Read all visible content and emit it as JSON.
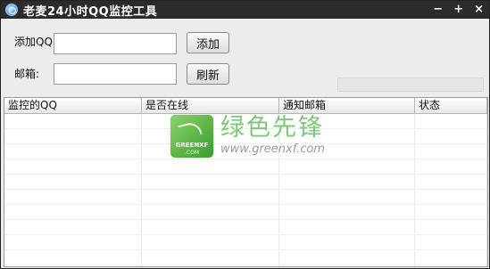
{
  "window": {
    "title": "老麦24小时QQ监控工具",
    "minimize": "−",
    "maximize": "+",
    "close": "×"
  },
  "form": {
    "qq_label": "添加QQ:",
    "qq_value": "",
    "add_button": "添加",
    "email_label": "邮箱:",
    "email_value": "",
    "refresh_button": "刷新"
  },
  "progress": {
    "value": 0
  },
  "table": {
    "columns": [
      "监控的QQ",
      "是否在线",
      "通知邮箱",
      "状态"
    ],
    "rows": []
  },
  "watermark": {
    "logo_text": "GREENXF",
    "logo_sub": ".COM",
    "brand_cn": "绿色先锋",
    "url": "www.greenxf.com"
  }
}
